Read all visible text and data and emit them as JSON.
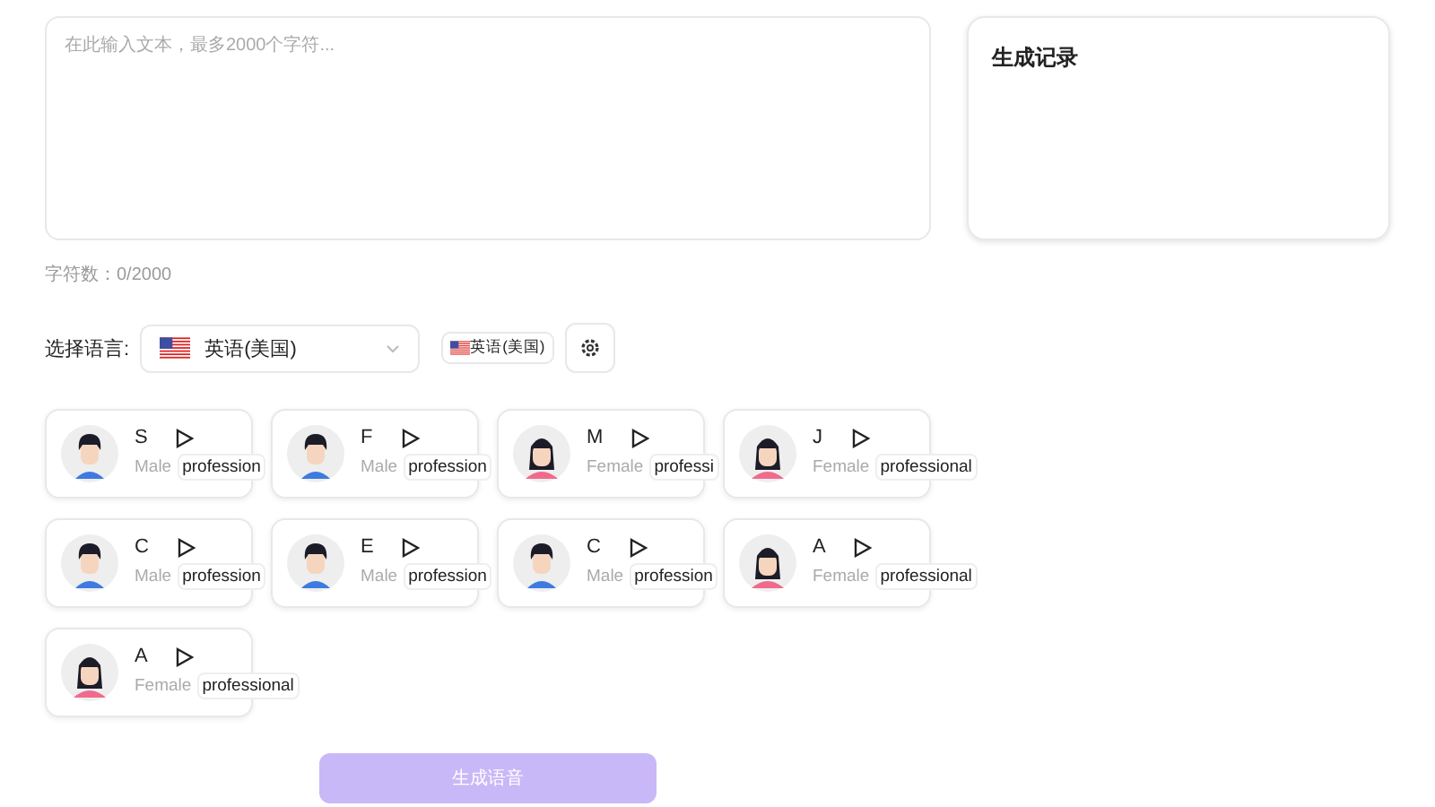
{
  "editor": {
    "placeholder": "在此输入文本，最多2000个字符...",
    "counter": "字符数：0/2000"
  },
  "history": {
    "title": "生成记录"
  },
  "language": {
    "label": "选择语言:",
    "selected": "英语(美国)",
    "tag": "英语(美国)"
  },
  "voices": [
    {
      "name": "S",
      "gender": "Male",
      "tag": "profession",
      "kind": "male"
    },
    {
      "name": "F",
      "gender": "Male",
      "tag": "profession",
      "kind": "male"
    },
    {
      "name": "M",
      "gender": "Female",
      "tag": "professi",
      "kind": "female"
    },
    {
      "name": "J",
      "gender": "Female",
      "tag": "professional",
      "kind": "female"
    },
    {
      "name": "C",
      "gender": "Male",
      "tag": "profession",
      "kind": "male"
    },
    {
      "name": "E",
      "gender": "Male",
      "tag": "profession",
      "kind": "male"
    },
    {
      "name": "C",
      "gender": "Male",
      "tag": "profession",
      "kind": "male"
    },
    {
      "name": "A",
      "gender": "Female",
      "tag": "professional",
      "kind": "female"
    },
    {
      "name": "A",
      "gender": "Female",
      "tag": "professional",
      "kind": "female"
    }
  ],
  "generate_button": {
    "label": "生成语音",
    "disabled": true
  }
}
